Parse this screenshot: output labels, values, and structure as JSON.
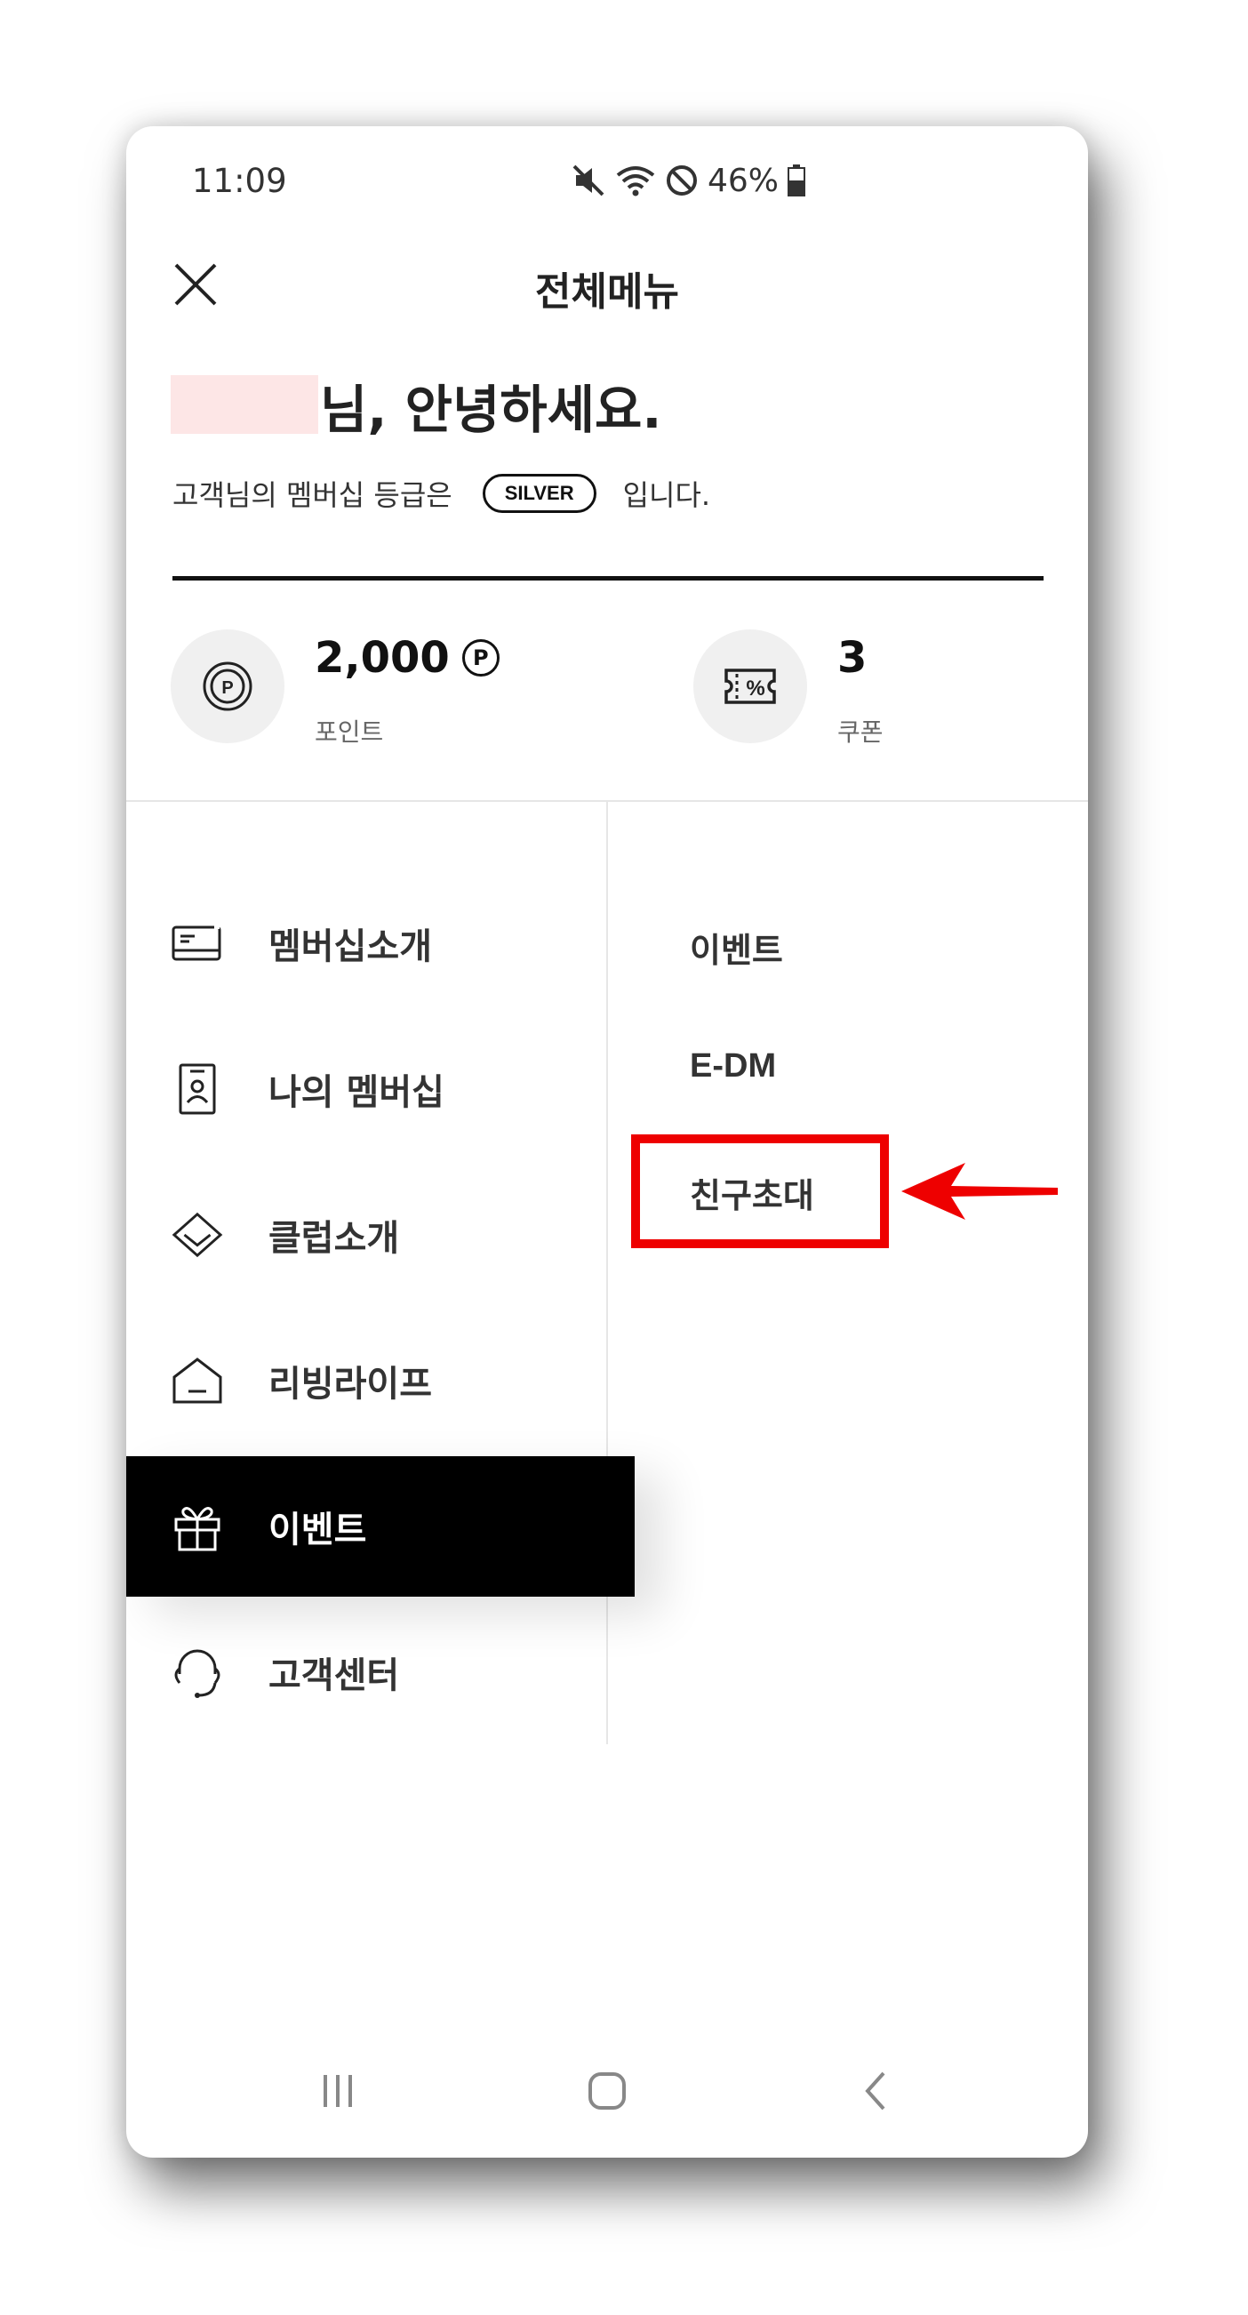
{
  "status_bar": {
    "time": "11:09",
    "battery": "46%"
  },
  "header": {
    "title": "전체메뉴"
  },
  "greeting": {
    "text": "님, 안녕하세요.",
    "grade_prefix": "고객님의 멤버십 등급은",
    "grade": "SILVER",
    "grade_suffix": "입니다."
  },
  "stats": {
    "points": {
      "value": "2,000",
      "unit": "P",
      "label": "포인트"
    },
    "coupons": {
      "value": "3",
      "label": "쿠폰"
    }
  },
  "left_menu": [
    {
      "label": "멤버십소개",
      "icon": "card-icon"
    },
    {
      "label": "나의 멤버십",
      "icon": "member-card-icon"
    },
    {
      "label": "클럽소개",
      "icon": "diamond-icon"
    },
    {
      "label": "리빙라이프",
      "icon": "house-icon"
    },
    {
      "label": "이벤트",
      "icon": "gift-icon",
      "active": true
    },
    {
      "label": "고객센터",
      "icon": "headset-icon"
    }
  ],
  "right_menu": [
    {
      "label": "이벤트"
    },
    {
      "label": "E-DM"
    },
    {
      "label": "친구초대",
      "highlighted": true
    }
  ],
  "colors": {
    "highlight": "#ee0000",
    "active_bg": "#000000",
    "name_mask": "#fde6e6"
  }
}
